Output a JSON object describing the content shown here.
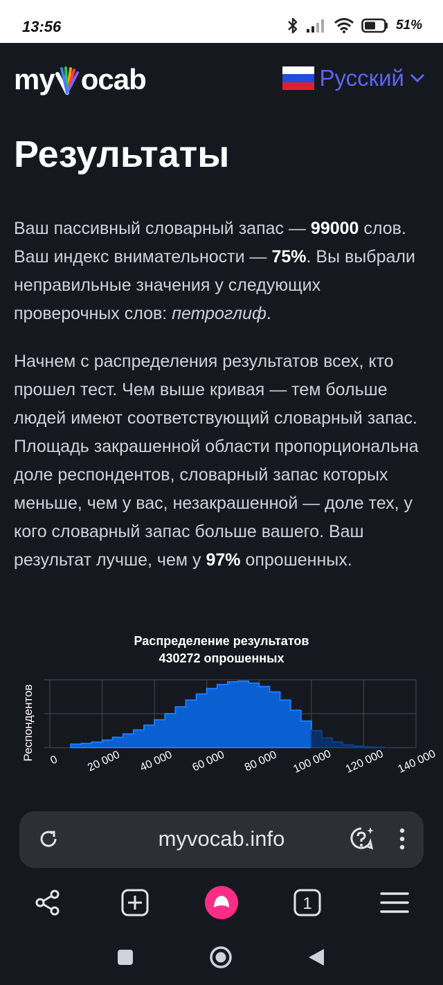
{
  "status_bar": {
    "time": "13:56",
    "battery": "51%"
  },
  "header": {
    "logo_left": "my",
    "logo_right": "ocab",
    "language": "Русский"
  },
  "page": {
    "title": "Результаты",
    "p1": {
      "t1": "Ваш пассивный словарный запас — ",
      "vocab": "99000",
      "t2": " слов. Ваш индекс внимательности — ",
      "attention": "75%",
      "t3": ". Вы выбрали неправильные значения у следующих проверочных слов: ",
      "word": "петроглиф",
      "t4": "."
    },
    "p2": {
      "t1": "Начнем с распределения результатов всех, кто прошел тест. Чем выше кривая — тем больше людей имеют соответствующий словарный запас. Площадь закрашенной области пропорциональна доле респондентов, словарный запас которых меньше, чем у вас, незакрашенной — доле тех, у кого словарный запас больше вашего. Ваш результат лучше, чем у ",
      "percent": "97%",
      "t2": " опрошенных."
    }
  },
  "chart_data": {
    "type": "area",
    "title": "Распределение результатов",
    "subtitle": "430272 опрошенных",
    "xlabel": "",
    "ylabel": "Респондентов",
    "xlim": [
      0,
      140000
    ],
    "x_ticks": [
      "0",
      "20 000",
      "40 000",
      "60 000",
      "80 000",
      "100 000",
      "120 000",
      "140 000"
    ],
    "user_value": 99000,
    "grid": true,
    "x": [
      10000,
      14000,
      18000,
      22000,
      26000,
      30000,
      34000,
      38000,
      42000,
      46000,
      50000,
      54000,
      58000,
      62000,
      66000,
      70000,
      74000,
      78000,
      82000,
      86000,
      90000,
      94000,
      98000,
      102000,
      106000,
      110000,
      114000,
      118000,
      122000,
      126000
    ],
    "values": [
      0.05,
      0.06,
      0.08,
      0.11,
      0.15,
      0.2,
      0.26,
      0.33,
      0.41,
      0.5,
      0.6,
      0.7,
      0.79,
      0.87,
      0.93,
      0.97,
      0.98,
      0.95,
      0.9,
      0.82,
      0.7,
      0.55,
      0.39,
      0.25,
      0.14,
      0.08,
      0.04,
      0.02,
      0.01,
      0.005
    ]
  },
  "browser": {
    "url": "myvocab.info",
    "tabs_count": "1"
  }
}
